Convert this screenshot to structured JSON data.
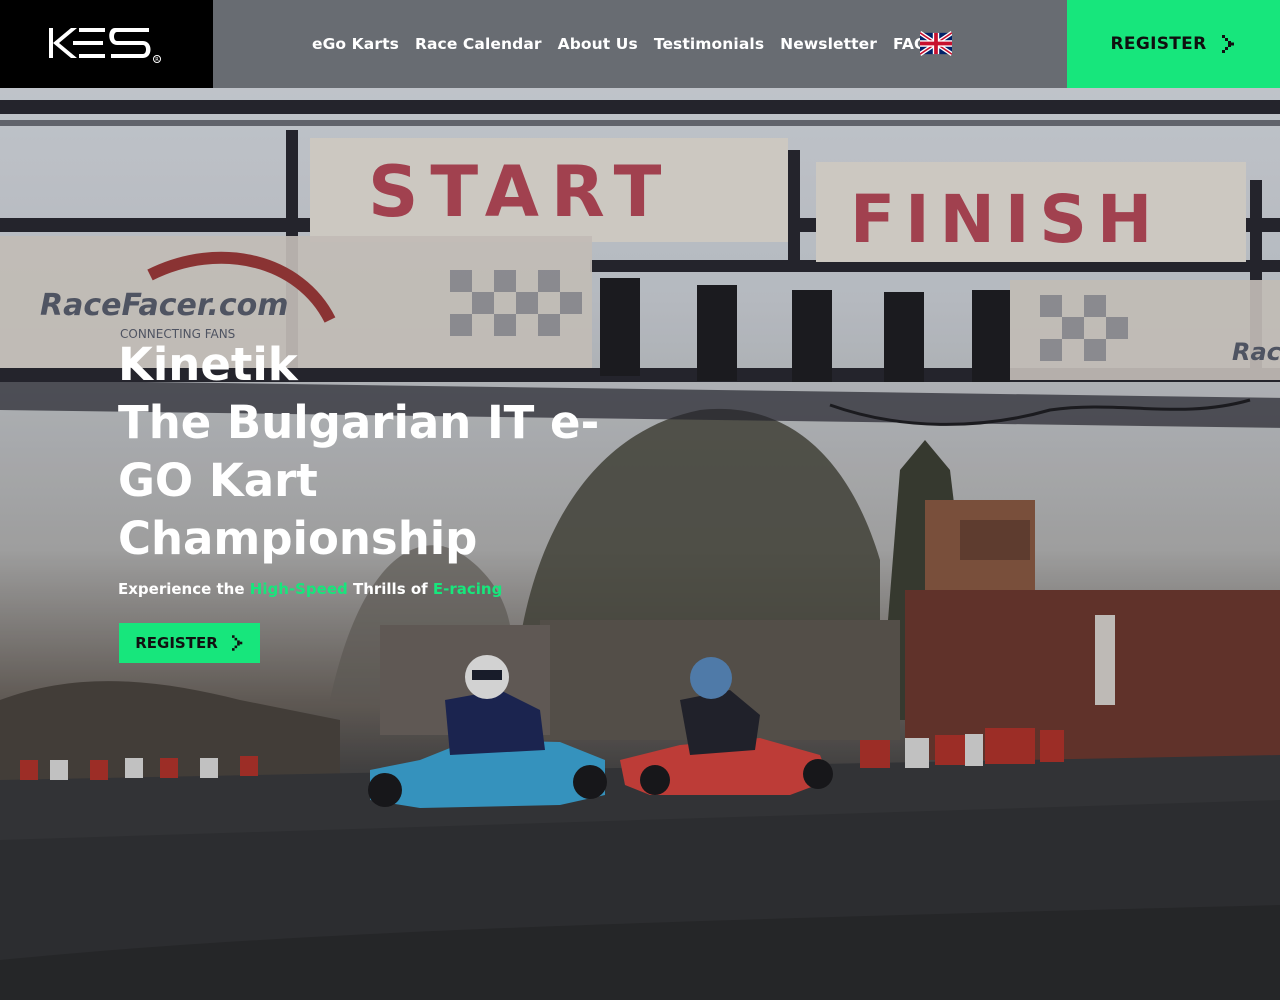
{
  "brand": {
    "logo_text": "KES",
    "registered_mark": "®"
  },
  "nav": {
    "items": [
      {
        "label": "eGo Karts"
      },
      {
        "label": "Race Calendar"
      },
      {
        "label": "About Us"
      },
      {
        "label": "Testimonials"
      },
      {
        "label": "Newsletter"
      },
      {
        "label": "FAQ"
      }
    ],
    "language_icon": "uk-flag-icon"
  },
  "header": {
    "register_label": "REGISTER",
    "register_icon": "chevron-right-icon"
  },
  "hero": {
    "title_lines": [
      "Kinetik",
      "The Bulgarian IT e-",
      "GO Kart",
      "Championship"
    ],
    "tagline": {
      "part1": "Experience the ",
      "highlight1": "High-Speed",
      "part2": " Thrills of ",
      "highlight2": "E-racing"
    },
    "register_label": "REGISTER",
    "background": {
      "banner_start": "START",
      "banner_finish": "FINISH",
      "sponsor": "RaceFacer.com",
      "sponsor_sub": "CONNECTING FANS",
      "sponsor_right": "Race"
    }
  },
  "colors": {
    "accent": "#17e67c",
    "header_bg": "#64686e",
    "logo_bg": "#000000"
  }
}
